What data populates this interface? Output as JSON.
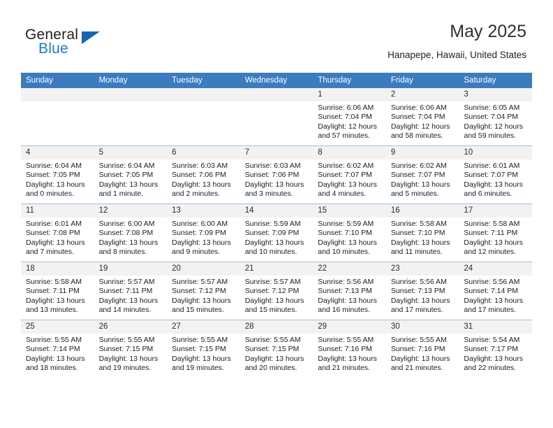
{
  "brand": {
    "name_part1": "General",
    "name_part2": "Blue",
    "flag_icon": "triangle-flag-icon"
  },
  "header": {
    "title": "May 2025",
    "location": "Hanapepe, Hawaii, United States"
  },
  "calendar": {
    "accent_color": "#3a7cbe",
    "daynum_band_color": "#f2f2f2",
    "weekday_headers": [
      "Sunday",
      "Monday",
      "Tuesday",
      "Wednesday",
      "Thursday",
      "Friday",
      "Saturday"
    ],
    "weeks": [
      [
        {
          "day": "",
          "empty": true
        },
        {
          "day": "",
          "empty": true
        },
        {
          "day": "",
          "empty": true
        },
        {
          "day": "",
          "empty": true
        },
        {
          "day": "1",
          "sunrise": "Sunrise: 6:06 AM",
          "sunset": "Sunset: 7:04 PM",
          "daylight": "Daylight: 12 hours and 57 minutes."
        },
        {
          "day": "2",
          "sunrise": "Sunrise: 6:06 AM",
          "sunset": "Sunset: 7:04 PM",
          "daylight": "Daylight: 12 hours and 58 minutes."
        },
        {
          "day": "3",
          "sunrise": "Sunrise: 6:05 AM",
          "sunset": "Sunset: 7:04 PM",
          "daylight": "Daylight: 12 hours and 59 minutes."
        }
      ],
      [
        {
          "day": "4",
          "sunrise": "Sunrise: 6:04 AM",
          "sunset": "Sunset: 7:05 PM",
          "daylight": "Daylight: 13 hours and 0 minutes."
        },
        {
          "day": "5",
          "sunrise": "Sunrise: 6:04 AM",
          "sunset": "Sunset: 7:05 PM",
          "daylight": "Daylight: 13 hours and 1 minute."
        },
        {
          "day": "6",
          "sunrise": "Sunrise: 6:03 AM",
          "sunset": "Sunset: 7:06 PM",
          "daylight": "Daylight: 13 hours and 2 minutes."
        },
        {
          "day": "7",
          "sunrise": "Sunrise: 6:03 AM",
          "sunset": "Sunset: 7:06 PM",
          "daylight": "Daylight: 13 hours and 3 minutes."
        },
        {
          "day": "8",
          "sunrise": "Sunrise: 6:02 AM",
          "sunset": "Sunset: 7:07 PM",
          "daylight": "Daylight: 13 hours and 4 minutes."
        },
        {
          "day": "9",
          "sunrise": "Sunrise: 6:02 AM",
          "sunset": "Sunset: 7:07 PM",
          "daylight": "Daylight: 13 hours and 5 minutes."
        },
        {
          "day": "10",
          "sunrise": "Sunrise: 6:01 AM",
          "sunset": "Sunset: 7:07 PM",
          "daylight": "Daylight: 13 hours and 6 minutes."
        }
      ],
      [
        {
          "day": "11",
          "sunrise": "Sunrise: 6:01 AM",
          "sunset": "Sunset: 7:08 PM",
          "daylight": "Daylight: 13 hours and 7 minutes."
        },
        {
          "day": "12",
          "sunrise": "Sunrise: 6:00 AM",
          "sunset": "Sunset: 7:08 PM",
          "daylight": "Daylight: 13 hours and 8 minutes."
        },
        {
          "day": "13",
          "sunrise": "Sunrise: 6:00 AM",
          "sunset": "Sunset: 7:09 PM",
          "daylight": "Daylight: 13 hours and 9 minutes."
        },
        {
          "day": "14",
          "sunrise": "Sunrise: 5:59 AM",
          "sunset": "Sunset: 7:09 PM",
          "daylight": "Daylight: 13 hours and 10 minutes."
        },
        {
          "day": "15",
          "sunrise": "Sunrise: 5:59 AM",
          "sunset": "Sunset: 7:10 PM",
          "daylight": "Daylight: 13 hours and 10 minutes."
        },
        {
          "day": "16",
          "sunrise": "Sunrise: 5:58 AM",
          "sunset": "Sunset: 7:10 PM",
          "daylight": "Daylight: 13 hours and 11 minutes."
        },
        {
          "day": "17",
          "sunrise": "Sunrise: 5:58 AM",
          "sunset": "Sunset: 7:11 PM",
          "daylight": "Daylight: 13 hours and 12 minutes."
        }
      ],
      [
        {
          "day": "18",
          "sunrise": "Sunrise: 5:58 AM",
          "sunset": "Sunset: 7:11 PM",
          "daylight": "Daylight: 13 hours and 13 minutes."
        },
        {
          "day": "19",
          "sunrise": "Sunrise: 5:57 AM",
          "sunset": "Sunset: 7:11 PM",
          "daylight": "Daylight: 13 hours and 14 minutes."
        },
        {
          "day": "20",
          "sunrise": "Sunrise: 5:57 AM",
          "sunset": "Sunset: 7:12 PM",
          "daylight": "Daylight: 13 hours and 15 minutes."
        },
        {
          "day": "21",
          "sunrise": "Sunrise: 5:57 AM",
          "sunset": "Sunset: 7:12 PM",
          "daylight": "Daylight: 13 hours and 15 minutes."
        },
        {
          "day": "22",
          "sunrise": "Sunrise: 5:56 AM",
          "sunset": "Sunset: 7:13 PM",
          "daylight": "Daylight: 13 hours and 16 minutes."
        },
        {
          "day": "23",
          "sunrise": "Sunrise: 5:56 AM",
          "sunset": "Sunset: 7:13 PM",
          "daylight": "Daylight: 13 hours and 17 minutes."
        },
        {
          "day": "24",
          "sunrise": "Sunrise: 5:56 AM",
          "sunset": "Sunset: 7:14 PM",
          "daylight": "Daylight: 13 hours and 17 minutes."
        }
      ],
      [
        {
          "day": "25",
          "sunrise": "Sunrise: 5:55 AM",
          "sunset": "Sunset: 7:14 PM",
          "daylight": "Daylight: 13 hours and 18 minutes."
        },
        {
          "day": "26",
          "sunrise": "Sunrise: 5:55 AM",
          "sunset": "Sunset: 7:15 PM",
          "daylight": "Daylight: 13 hours and 19 minutes."
        },
        {
          "day": "27",
          "sunrise": "Sunrise: 5:55 AM",
          "sunset": "Sunset: 7:15 PM",
          "daylight": "Daylight: 13 hours and 19 minutes."
        },
        {
          "day": "28",
          "sunrise": "Sunrise: 5:55 AM",
          "sunset": "Sunset: 7:15 PM",
          "daylight": "Daylight: 13 hours and 20 minutes."
        },
        {
          "day": "29",
          "sunrise": "Sunrise: 5:55 AM",
          "sunset": "Sunset: 7:16 PM",
          "daylight": "Daylight: 13 hours and 21 minutes."
        },
        {
          "day": "30",
          "sunrise": "Sunrise: 5:55 AM",
          "sunset": "Sunset: 7:16 PM",
          "daylight": "Daylight: 13 hours and 21 minutes."
        },
        {
          "day": "31",
          "sunrise": "Sunrise: 5:54 AM",
          "sunset": "Sunset: 7:17 PM",
          "daylight": "Daylight: 13 hours and 22 minutes."
        }
      ]
    ]
  }
}
